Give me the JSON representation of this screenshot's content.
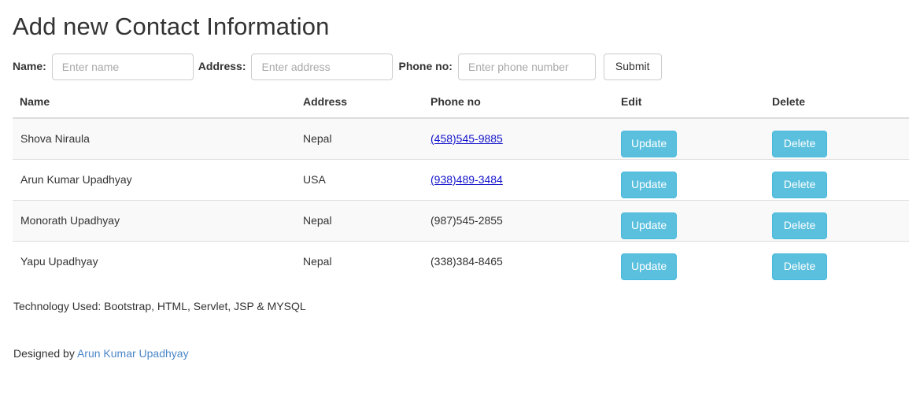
{
  "page": {
    "title": "Add new Contact Information"
  },
  "form": {
    "name_label": "Name:",
    "name_placeholder": "Enter name",
    "name_value": "",
    "address_label": "Address:",
    "address_placeholder": "Enter address",
    "address_value": "",
    "phone_label": "Phone no:",
    "phone_placeholder": "Enter phone number",
    "phone_value": "",
    "submit_label": "Submit"
  },
  "table": {
    "headers": {
      "name": "Name",
      "address": "Address",
      "phone": "Phone no",
      "edit": "Edit",
      "delete": "Delete"
    },
    "update_label": "Update",
    "delete_label": "Delete",
    "rows": [
      {
        "name": "Shova Niraula",
        "address": "Nepal",
        "phone": "(458)545-9885",
        "phone_is_link": true,
        "update": "Update",
        "delete": "Delete"
      },
      {
        "name": "Arun Kumar Upadhyay",
        "address": "USA",
        "phone": "(938)489-3484",
        "phone_is_link": true,
        "update": "Update",
        "delete": "Delete"
      },
      {
        "name": "Monorath Upadhyay",
        "address": "Nepal",
        "phone": "(987)545-2855",
        "phone_is_link": false,
        "update": "Update",
        "delete": "Delete"
      },
      {
        "name": "Yapu Upadhyay",
        "address": "Nepal",
        "phone": "(338)384-8465",
        "phone_is_link": false,
        "update": "Update",
        "delete": "Delete"
      }
    ]
  },
  "footer": {
    "tech_note": "Technology Used: Bootstrap, HTML, Servlet, JSP & MYSQL",
    "designed_prefix": "Designed by ",
    "designer_name": "Arun Kumar Upadhyay"
  },
  "colors": {
    "action_button": "#5bc0de",
    "action_button_border": "#46b8da",
    "phone_link": "#1414cc",
    "designer_link": "#4a86c8",
    "stripe": "#f9f9f9",
    "border": "#dddddd"
  }
}
